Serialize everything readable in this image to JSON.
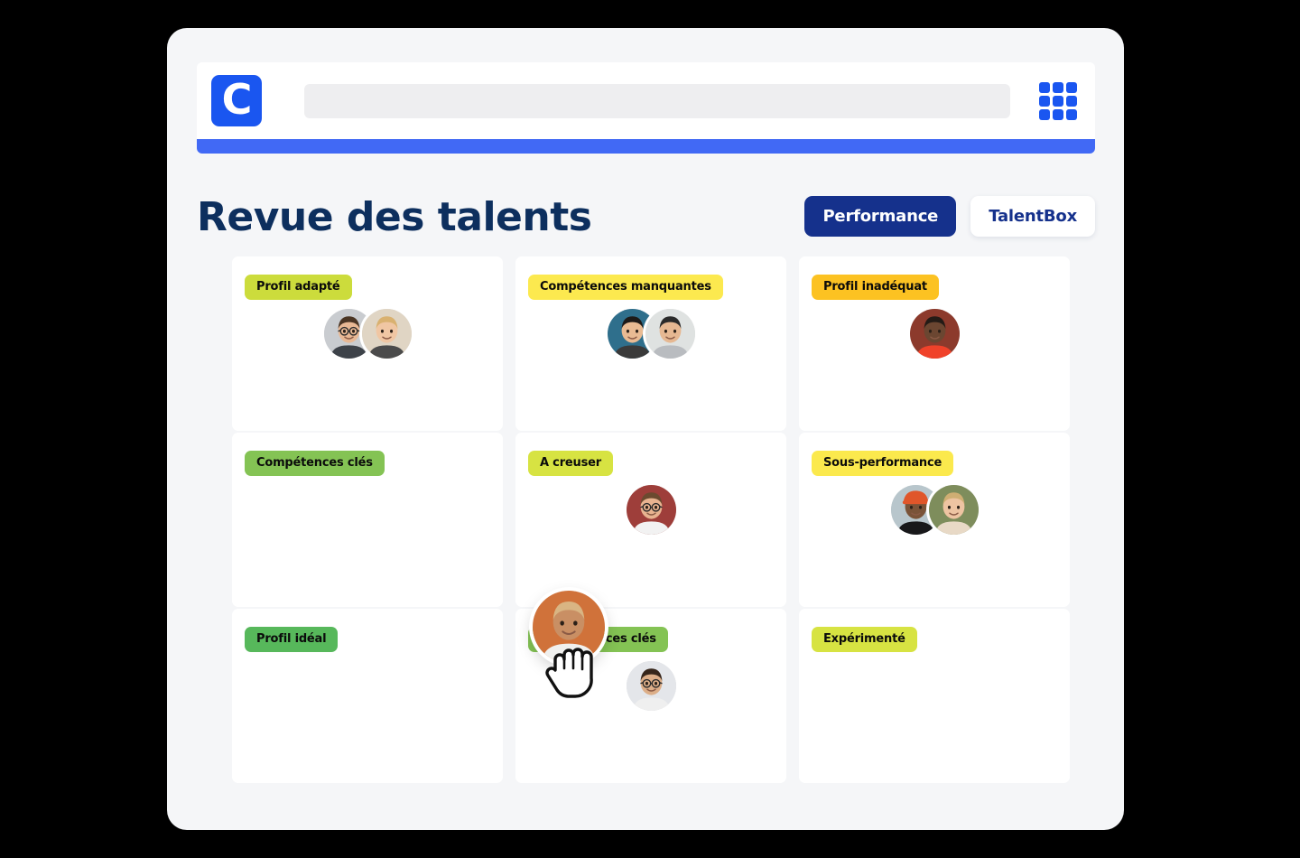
{
  "app": {
    "logo_letter": "C",
    "logo_color": "#1a56f0",
    "accent_bar_color": "#4169f5",
    "grid_icon_name": "apps-grid-icon",
    "window_bg": "#f5f6f8"
  },
  "search": {
    "value": "",
    "placeholder": ""
  },
  "header": {
    "title": "Revue des talents",
    "title_color": "#0d2f5e",
    "toggle": {
      "active_label": "Performance",
      "inactive_label": "TalentBox",
      "active_bg": "#15318c",
      "inactive_bg": "#ffffff"
    }
  },
  "board": {
    "cells": [
      {
        "badge": "Profil adapté",
        "badge_color": "#ccdc3c",
        "avatar_count": 2,
        "avatars": [
          {
            "name": "avatar-man-glasses-beard",
            "bg": "#c9ccd0",
            "skin": "#e8b894",
            "hair": "#4a3524",
            "shirt": "#3d4249",
            "glasses": true
          },
          {
            "name": "avatar-woman-blonde",
            "bg": "#e0d5c4",
            "skin": "#f0c6a3",
            "hair": "#d9b170",
            "shirt": "#4b4b4b",
            "glasses": false
          }
        ]
      },
      {
        "badge": "Compétences manquantes",
        "badge_color": "#fce94f",
        "avatar_count": 2,
        "avatars": [
          {
            "name": "avatar-woman-dark-hair",
            "bg": "#2f6f8c",
            "skin": "#e9bb93",
            "hair": "#1d1a18",
            "shirt": "#3a3a3a",
            "glasses": false
          },
          {
            "name": "avatar-man-cap",
            "bg": "#dfe2e1",
            "skin": "#e6b892",
            "hair": "#2a2a2a",
            "shirt": "#b9bcc0",
            "glasses": false
          }
        ]
      },
      {
        "badge": "Profil inadéquat",
        "badge_color": "#fcc222",
        "avatar_count": 1,
        "avatars": [
          {
            "name": "avatar-woman-red-top",
            "bg": "#8c3a2c",
            "skin": "#6b4631",
            "hair": "#241b16",
            "shirt": "#f0422a",
            "glasses": false
          }
        ]
      },
      {
        "badge": "Compétences clés",
        "badge_color": "#84c354",
        "avatar_count": 0,
        "avatars": []
      },
      {
        "badge": "A creuser",
        "badge_color": "#d7e342",
        "avatar_count": 1,
        "avatars": [
          {
            "name": "avatar-man-glasses-smiling",
            "bg": "#9e3e3a",
            "skin": "#e8b390",
            "hair": "#6b4a2f",
            "shirt": "#f2f2f2",
            "glasses": true
          }
        ]
      },
      {
        "badge": "Sous-performance",
        "badge_color": "#fbe94d",
        "avatar_count": 2,
        "avatars": [
          {
            "name": "avatar-man-orange-beanie",
            "bg": "#b8c6cc",
            "skin": "#7a5338",
            "hair": "#1c1c1c",
            "shirt": "#18181a",
            "hat": "#e0562a",
            "glasses": false
          },
          {
            "name": "avatar-woman-blonde-outdoors",
            "bg": "#7e8d5c",
            "skin": "#eec4a2",
            "hair": "#cfae73",
            "shirt": "#e8d9c6",
            "glasses": false
          }
        ]
      },
      {
        "badge": "Profil idéal",
        "badge_color": "#57b85b",
        "avatar_count": 0,
        "avatars": []
      },
      {
        "badge": "Compétences clés",
        "badge_color": "#84c354",
        "avatar_count": 1,
        "avatars": [
          {
            "name": "avatar-man-glasses-curly",
            "bg": "#e4e6ea",
            "skin": "#dcae88",
            "hair": "#36261b",
            "shirt": "#efefef",
            "glasses": true
          }
        ]
      },
      {
        "badge": "Expérimenté",
        "badge_color": "#d7e342",
        "avatar_count": 0,
        "avatars": []
      }
    ]
  },
  "drag": {
    "avatar_name": "avatar-woman-curly-hair-dragged",
    "cursor_name": "grabbing-hand-cursor",
    "bg": "#d0723a",
    "skin": "#c98f64",
    "hair": "#d9b583",
    "shirt": "#f0f0ee"
  }
}
